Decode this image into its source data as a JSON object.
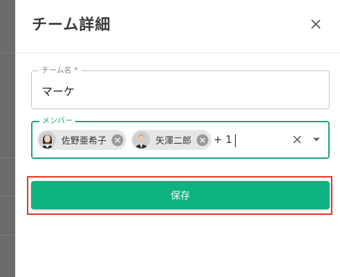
{
  "dialog": {
    "title": "チーム詳細",
    "close_icon": "close-icon"
  },
  "team_name": {
    "label": "チーム名 *",
    "value": "マーケ"
  },
  "members": {
    "label": "メンバー",
    "chips": [
      {
        "name": "佐野亜希子",
        "avatar": "female-avatar"
      },
      {
        "name": "矢澤二郎",
        "avatar": "male-avatar"
      }
    ],
    "more_count": "+ 1",
    "clear_icon": "clear-icon",
    "dropdown_icon": "chevron-down-icon"
  },
  "actions": {
    "save_label": "保存"
  },
  "colors": {
    "accent": "#0fb281",
    "focus_border": "#1aa37a",
    "highlight": "#e8331f"
  }
}
